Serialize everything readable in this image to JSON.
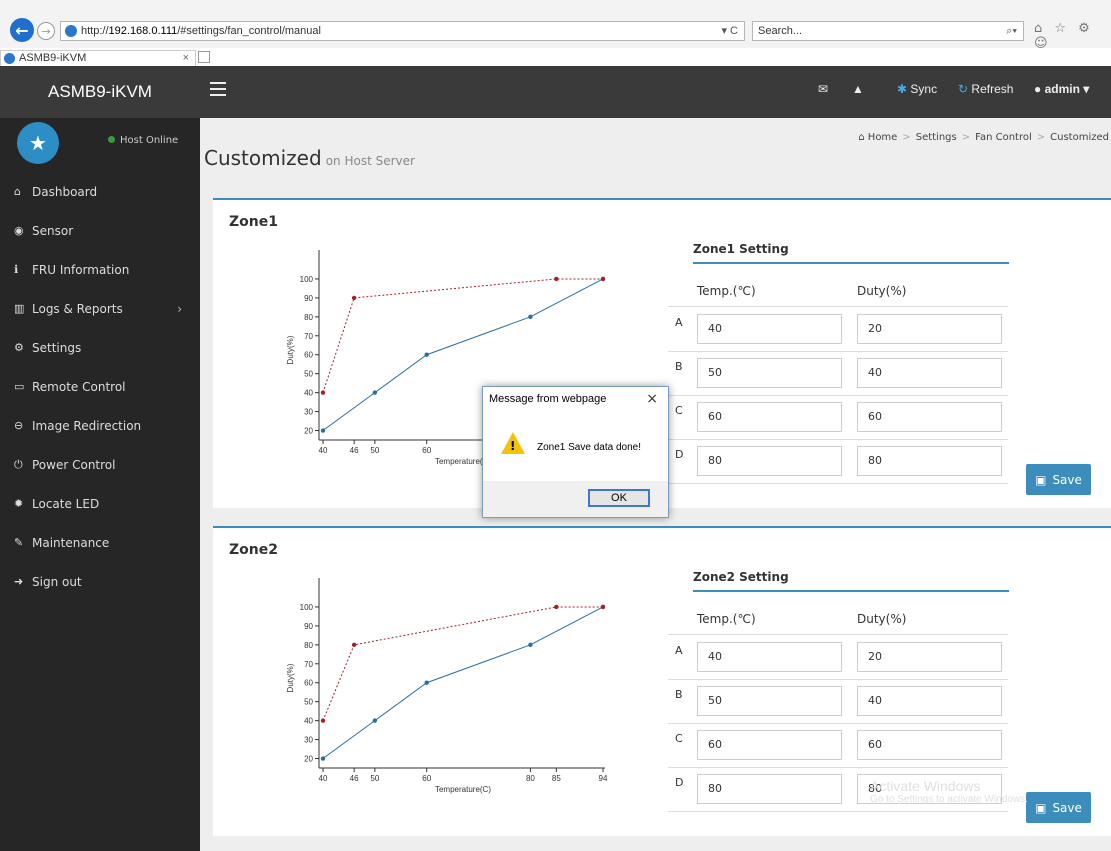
{
  "browser": {
    "url_prefix": "http://",
    "url_host": "192.168.0.111",
    "url_path": "/#settings/fan_control/manual",
    "url_tools": "▾ C",
    "search_placeholder": "Search...",
    "search_icon": "search-icon",
    "tab_label": "ASMB9-iKVM",
    "tab_close": "×",
    "toolbar_icons": "⌂ ☆ ⚙ ☺",
    "window_controls": "— ▢ ×"
  },
  "sidebar": {
    "brand": "ASMB9-iKVM",
    "host_status": "Host Online",
    "items": [
      {
        "label": "Dashboard",
        "icon": "home-icon",
        "glyph": "⌂"
      },
      {
        "label": "Sensor",
        "icon": "sensor-icon",
        "glyph": "◉"
      },
      {
        "label": "FRU Information",
        "icon": "info-icon",
        "glyph": "ℹ"
      },
      {
        "label": "Logs & Reports",
        "icon": "bar-chart-icon",
        "glyph": "▥"
      },
      {
        "label": "Settings",
        "icon": "gear-icon",
        "glyph": "⚙"
      },
      {
        "label": "Remote Control",
        "icon": "monitor-icon",
        "glyph": "▭"
      },
      {
        "label": "Image Redirection",
        "icon": "disk-icon",
        "glyph": "⊖"
      },
      {
        "label": "Power Control",
        "icon": "power-icon",
        "glyph": "⏻"
      },
      {
        "label": "Locate LED",
        "icon": "gear-icon",
        "glyph": "✹"
      },
      {
        "label": "Maintenance",
        "icon": "wrench-icon",
        "glyph": "✎"
      },
      {
        "label": "Sign out",
        "icon": "signout-icon",
        "glyph": "➜"
      }
    ]
  },
  "topbar": {
    "sync": "Sync",
    "refresh": "Refresh",
    "user": "admin"
  },
  "page": {
    "title": "Customized",
    "subtitle": "on Host Server",
    "breadcrumb": [
      "Home",
      "Settings",
      "Fan Control",
      "Customized"
    ]
  },
  "zones": [
    {
      "title": "Zone1",
      "setting_title": "Zone1 Setting",
      "temp_header": "Temp.(℃)",
      "duty_header": "Duty(%)",
      "rows": [
        {
          "letter": "A",
          "temp": "40",
          "duty": "20"
        },
        {
          "letter": "B",
          "temp": "50",
          "duty": "40"
        },
        {
          "letter": "C",
          "temp": "60",
          "duty": "60"
        },
        {
          "letter": "D",
          "temp": "80",
          "duty": "80"
        }
      ],
      "save": "Save"
    },
    {
      "title": "Zone2",
      "setting_title": "Zone2 Setting",
      "temp_header": "Temp.(℃)",
      "duty_header": "Duty(%)",
      "rows": [
        {
          "letter": "A",
          "temp": "40",
          "duty": "20"
        },
        {
          "letter": "B",
          "temp": "50",
          "duty": "40"
        },
        {
          "letter": "C",
          "temp": "60",
          "duty": "60"
        },
        {
          "letter": "D",
          "temp": "80",
          "duty": "80"
        }
      ],
      "save": "Save"
    }
  ],
  "chart_data": [
    {
      "type": "line",
      "xlabel": "Temperature(C)",
      "ylabel": "Duty(%)",
      "xticks": [
        40,
        46,
        50,
        60,
        80,
        85,
        94
      ],
      "yticks": [
        20,
        30,
        40,
        50,
        60,
        70,
        80,
        90,
        100
      ],
      "xlim": [
        40,
        94
      ],
      "ylim": [
        15,
        110
      ],
      "series": [
        {
          "color": "#2c6e9e",
          "style": "solid",
          "x": [
            40,
            50,
            60,
            80,
            94
          ],
          "y": [
            20,
            40,
            60,
            80,
            100
          ]
        },
        {
          "color": "#a2202a",
          "style": "dotted",
          "x": [
            40,
            46,
            85,
            94
          ],
          "y": [
            40,
            90,
            100,
            100
          ]
        }
      ]
    },
    {
      "type": "line",
      "xlabel": "Temperature(C)",
      "ylabel": "Duty(%)",
      "xticks": [
        40,
        46,
        50,
        60,
        80,
        85,
        94
      ],
      "yticks": [
        20,
        30,
        40,
        50,
        60,
        70,
        80,
        90,
        100
      ],
      "xlim": [
        40,
        94
      ],
      "ylim": [
        15,
        110
      ],
      "series": [
        {
          "color": "#2c6e9e",
          "style": "solid",
          "x": [
            40,
            50,
            60,
            80,
            94
          ],
          "y": [
            20,
            40,
            60,
            80,
            100
          ]
        },
        {
          "color": "#a2202a",
          "style": "dotted",
          "x": [
            40,
            46,
            85,
            94
          ],
          "y": [
            40,
            80,
            100,
            100
          ]
        }
      ]
    }
  ],
  "dialog": {
    "title": "Message from webpage",
    "message": "Zone1 Save data done!",
    "ok": "OK",
    "close": "×"
  },
  "watermark": {
    "line1": "Activate Windows",
    "line2": "Go to Settings to activate Windows."
  },
  "colors": {
    "accent": "#3c8dbc",
    "sidebar_bg": "#262626",
    "status_online": "#3c9a3c"
  }
}
